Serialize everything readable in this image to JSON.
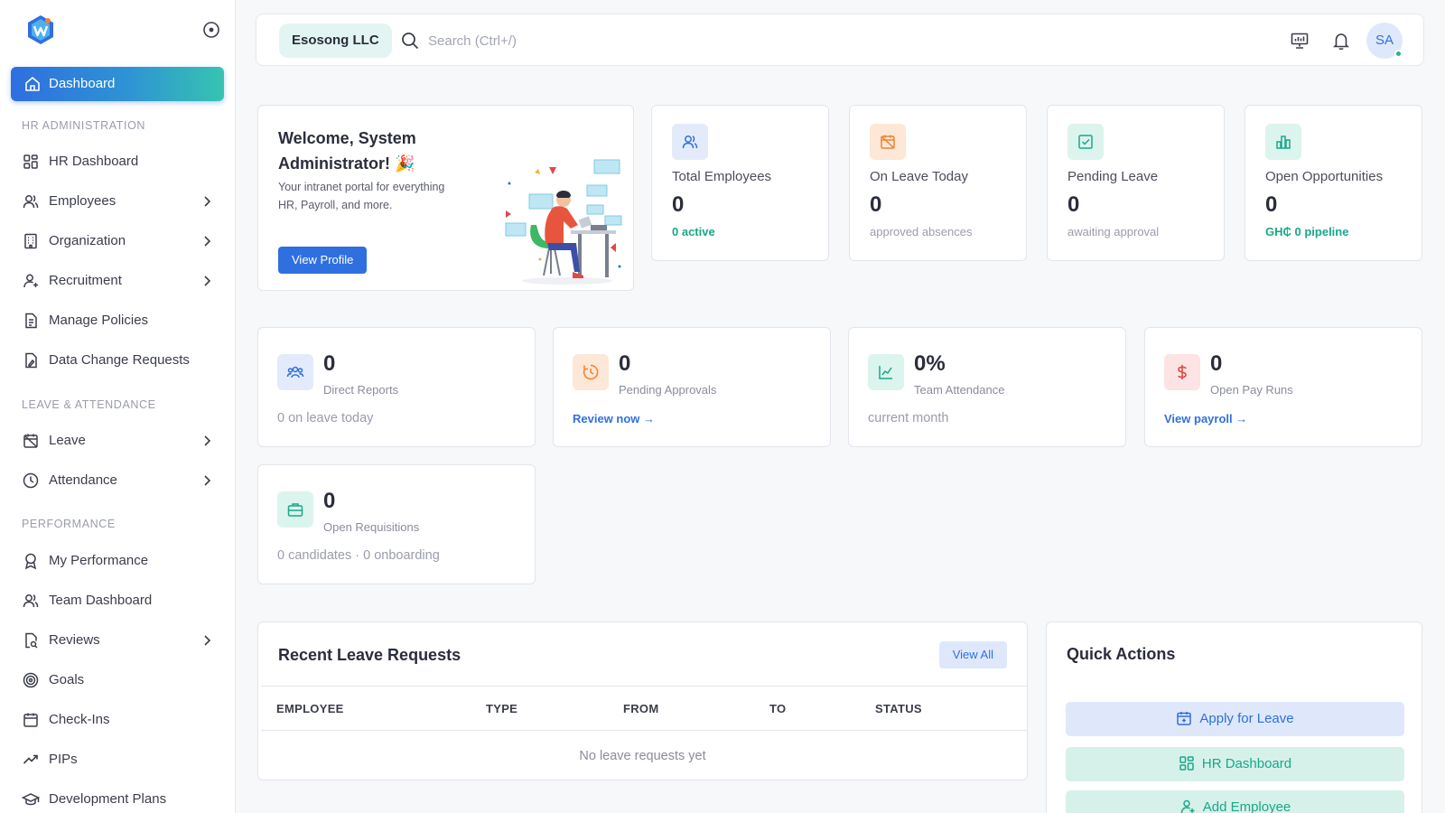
{
  "sidebar": {
    "active": {
      "label": "Dashboard",
      "icon": "home-icon"
    },
    "sections": [
      {
        "title": "HR ADMINISTRATION"
      },
      {
        "title": "LEAVE & ATTENDANCE"
      },
      {
        "title": "PERFORMANCE"
      }
    ],
    "items": [
      {
        "label": "HR Dashboard",
        "icon": "grid-icon"
      },
      {
        "label": "Employees",
        "icon": "users-icon"
      },
      {
        "label": "Organization",
        "icon": "building-icon"
      },
      {
        "label": "Recruitment",
        "icon": "user-plus-icon"
      },
      {
        "label": "Manage Policies",
        "icon": "document-icon"
      },
      {
        "label": "Data Change Requests",
        "icon": "file-edit-icon"
      },
      {
        "label": "Leave",
        "icon": "calendar-off-icon"
      },
      {
        "label": "Attendance",
        "icon": "clock-icon"
      },
      {
        "label": "My Performance",
        "icon": "award-icon"
      },
      {
        "label": "Team Dashboard",
        "icon": "users-icon"
      },
      {
        "label": "Reviews",
        "icon": "file-search-icon"
      },
      {
        "label": "Goals",
        "icon": "target-icon"
      },
      {
        "label": "Check-Ins",
        "icon": "calendar-icon"
      },
      {
        "label": "PIPs",
        "icon": "trending-up-icon"
      },
      {
        "label": "Development Plans",
        "icon": "graduation-cap-icon"
      }
    ]
  },
  "topbar": {
    "company": "Esosong LLC",
    "search_placeholder": "Search (Ctrl+/)",
    "avatar_initials": "SA"
  },
  "welcome": {
    "title": "Welcome, System Administrator! 🎉",
    "text": "Your intranet portal for everything HR, Payroll, and more.",
    "button": "View Profile"
  },
  "stats": [
    {
      "label": "Total Employees",
      "value": "0",
      "sub": "0 active",
      "icon": "users-icon",
      "color": "#2f6fe0",
      "bg": "#e3ebfb"
    },
    {
      "label": "On Leave Today",
      "value": "0",
      "sub": "approved absences",
      "icon": "calendar-off-icon",
      "color": "#f08232",
      "bg": "#fde7d6"
    },
    {
      "label": "Pending Leave",
      "value": "0",
      "sub": "awaiting approval",
      "icon": "calendar-check-icon",
      "color": "#18a88a",
      "bg": "#dcf4ee"
    },
    {
      "label": "Open Opportunities",
      "value": "0",
      "sub": "GH₵ 0 pipeline",
      "icon": "bar-chart-icon",
      "color": "#18a88a",
      "bg": "#dcf4ee"
    }
  ],
  "metrics": [
    {
      "value": "0",
      "label": "Direct Reports",
      "sub": "0 on leave today",
      "icon": "team-icon"
    },
    {
      "value": "0",
      "label": "Pending Approvals",
      "link": "Review now →",
      "icon": "clock-alert-icon"
    },
    {
      "value": "0%",
      "label": "Team Attendance",
      "sub": "current month",
      "icon": "chart-line-icon"
    },
    {
      "value": "0",
      "label": "Open Pay Runs",
      "link": "View payroll →",
      "icon": "dollar-icon"
    },
    {
      "value": "0",
      "label": "Open Requisitions",
      "sub": "0 candidates · 0 onboarding",
      "icon": "briefcase-icon"
    }
  ],
  "leave_requests": {
    "title": "Recent Leave Requests",
    "view_all": "View All",
    "columns": [
      "EMPLOYEE",
      "TYPE",
      "FROM",
      "TO",
      "STATUS"
    ],
    "empty": "No leave requests yet"
  },
  "quick_actions": {
    "title": "Quick Actions",
    "buttons": [
      {
        "label": "Apply for Leave",
        "icon": "calendar-plus-icon"
      },
      {
        "label": "HR Dashboard",
        "icon": "grid-icon"
      },
      {
        "label": "Add Employee",
        "icon": "user-plus-icon"
      }
    ]
  }
}
